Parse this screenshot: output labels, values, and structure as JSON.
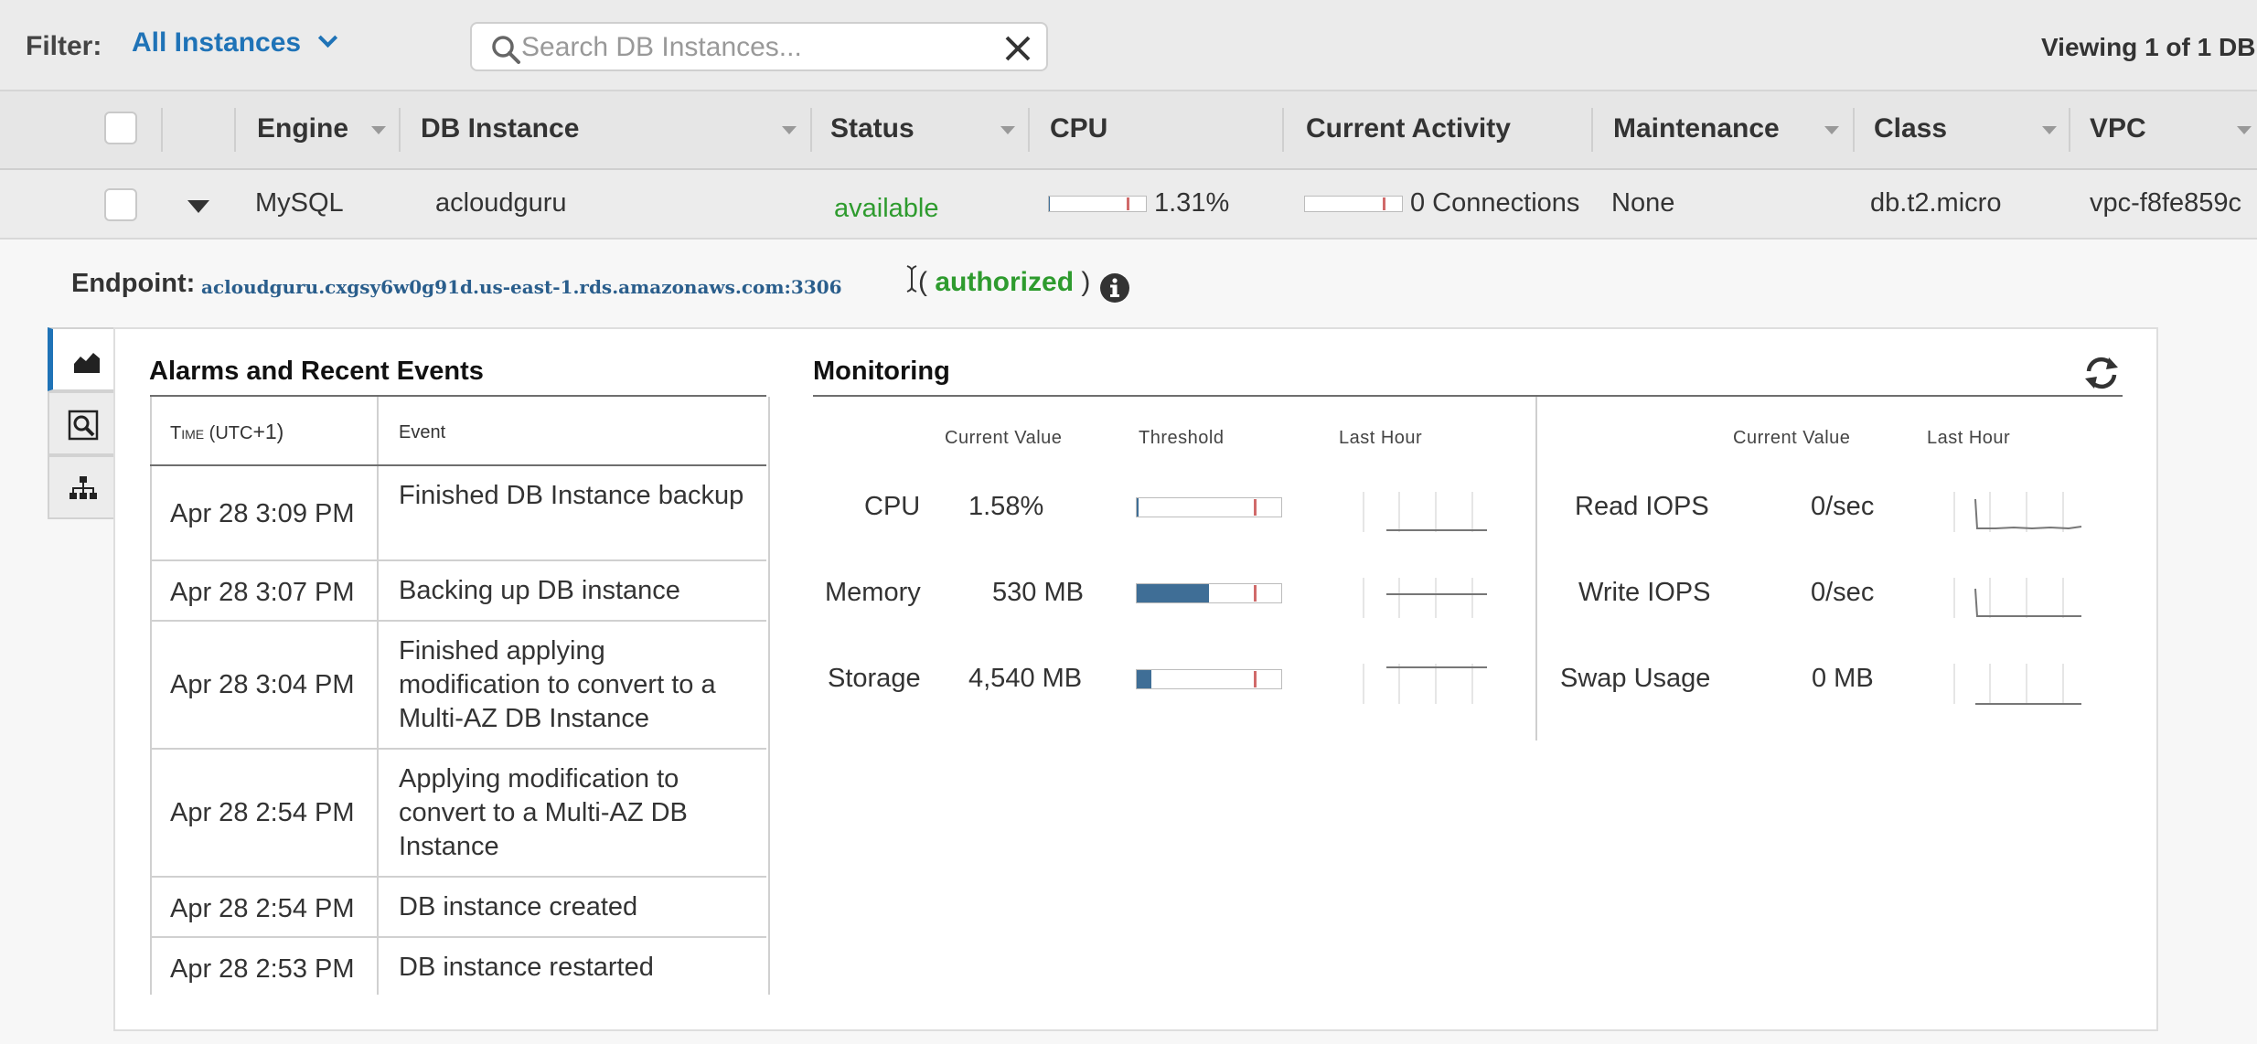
{
  "filter": {
    "label": "Filter:",
    "selected": "All Instances",
    "search_placeholder": "Search DB Instances...",
    "viewing_text": "Viewing 1 of 1 DB"
  },
  "table": {
    "headers": {
      "engine": "Engine",
      "db_instance": "DB Instance",
      "status": "Status",
      "cpu": "CPU",
      "current_activity": "Current Activity",
      "maintenance": "Maintenance",
      "class": "Class",
      "vpc": "VPC"
    },
    "row": {
      "engine": "MySQL",
      "db_instance": "acloudguru",
      "status": "available",
      "cpu": "1.31%",
      "cpu_fraction": 0.0131,
      "current_activity": "0 Connections",
      "maintenance": "None",
      "class": "db.t2.micro",
      "vpc": "vpc-f8fe859c"
    }
  },
  "details": {
    "endpoint_label": "Endpoint:",
    "endpoint_value": "acloudguru.cxgsy6w0g91d.us-east-1.rds.amazonaws.com:3306",
    "authorized": "authorized",
    "paren_open": "(",
    "paren_close": ")"
  },
  "events": {
    "title": "Alarms and Recent Events",
    "col_time_small": "Time",
    "col_time_utc": "(UTC",
    "col_time_offset": "+1)",
    "col_event": "Event",
    "rows": [
      {
        "time": "Apr 28 3:09 PM",
        "event": "Finished DB Instance backup"
      },
      {
        "time": "Apr 28 3:07 PM",
        "event": "Backing up DB instance"
      },
      {
        "time": "Apr 28 3:04 PM",
        "event": "Finished applying modification to convert to a Multi-AZ DB Instance"
      },
      {
        "time": "Apr 28 2:54 PM",
        "event": "Applying modification to convert to a Multi-AZ DB Instance"
      },
      {
        "time": "Apr 28 2:54 PM",
        "event": "DB instance created"
      },
      {
        "time": "Apr 28 2:53 PM",
        "event": "DB instance restarted"
      }
    ]
  },
  "monitoring": {
    "title": "Monitoring",
    "headers": {
      "current_value": "Current Value",
      "threshold": "Threshold",
      "last_hour": "Last Hour",
      "current_value_2": "Current Value",
      "last_hour_2": "Last Hour"
    },
    "left": [
      {
        "label": "CPU",
        "value": "1.58%",
        "fill_fraction": 0.0158
      },
      {
        "label": "Memory",
        "value": "530 MB",
        "fill_fraction": 0.5
      },
      {
        "label": "Storage",
        "value": "4,540 MB",
        "fill_fraction": 0.1
      }
    ],
    "right": [
      {
        "label": "Read IOPS",
        "value": "0/sec"
      },
      {
        "label": "Write IOPS",
        "value": "0/sec"
      },
      {
        "label": "Swap Usage",
        "value": "0 MB"
      }
    ]
  },
  "colors": {
    "accent": "#1f73b7",
    "status_ok": "#2e9b2e",
    "bar_fill": "#3f6e96",
    "threshold_mark": "#d06a6a"
  },
  "icons": {
    "filter_chevron": "chevron-down-icon",
    "search": "search-icon",
    "clear": "close-icon",
    "info": "info-icon",
    "refresh": "refresh-icon",
    "tab1": "area-chart-icon",
    "tab2": "magnifier-icon",
    "tab3": "hierarchy-icon"
  }
}
